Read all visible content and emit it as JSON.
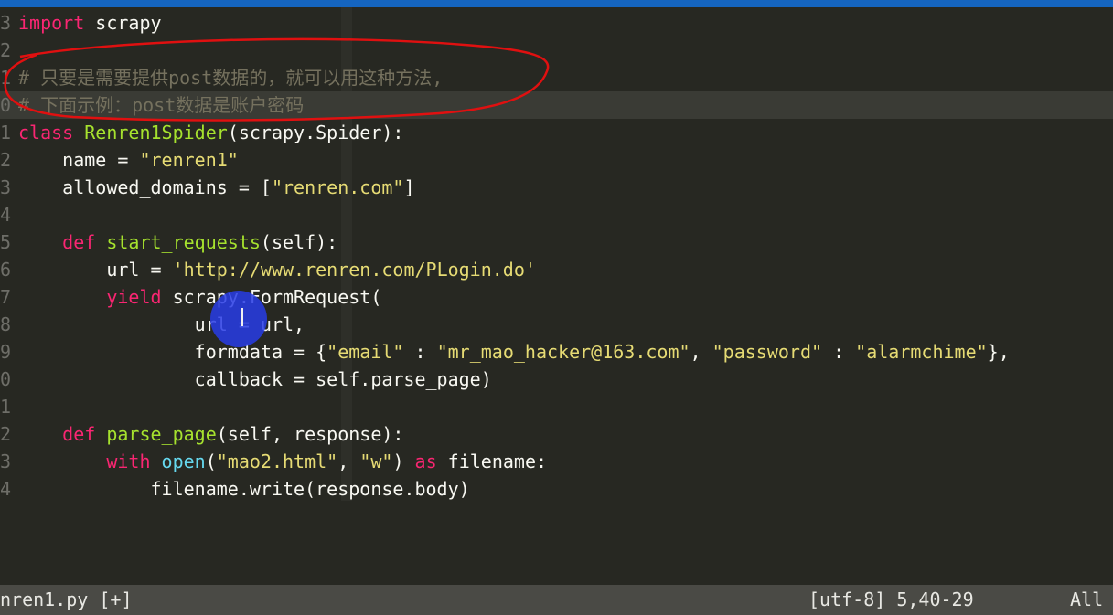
{
  "editor": {
    "lines": [
      {
        "ln": "3",
        "tokens": [
          {
            "t": "import",
            "c": "kw"
          },
          {
            "t": " scrapy",
            "c": "tok"
          }
        ]
      },
      {
        "ln": "2",
        "tokens": []
      },
      {
        "ln": "1",
        "tokens": [
          {
            "t": "# 只要是需要提供post数据的，就可以用这种方法,",
            "c": "com"
          }
        ]
      },
      {
        "ln": "0",
        "tokens": [
          {
            "t": "# 下面示例：post数据是账户密码",
            "c": "com"
          }
        ]
      },
      {
        "ln": "1",
        "tokens": [
          {
            "t": "class",
            "c": "kw"
          },
          {
            "t": " ",
            "c": "tok"
          },
          {
            "t": "Renren1Spider",
            "c": "cls"
          },
          {
            "t": "(scrapy.Spider):",
            "c": "tok"
          }
        ]
      },
      {
        "ln": "2",
        "tokens": [
          {
            "t": "    name = ",
            "c": "tok"
          },
          {
            "t": "\"renren1\"",
            "c": "str"
          }
        ]
      },
      {
        "ln": "3",
        "tokens": [
          {
            "t": "    allowed_domains = [",
            "c": "tok"
          },
          {
            "t": "\"renren.com\"",
            "c": "str"
          },
          {
            "t": "]",
            "c": "tok"
          }
        ]
      },
      {
        "ln": "4",
        "tokens": []
      },
      {
        "ln": "5",
        "tokens": [
          {
            "t": "    ",
            "c": "tok"
          },
          {
            "t": "def",
            "c": "kw"
          },
          {
            "t": " ",
            "c": "tok"
          },
          {
            "t": "start_requests",
            "c": "fn"
          },
          {
            "t": "(self):",
            "c": "tok"
          }
        ]
      },
      {
        "ln": "6",
        "tokens": [
          {
            "t": "        url = ",
            "c": "tok"
          },
          {
            "t": "'http://www.renren.com/PLogin.do'",
            "c": "str"
          }
        ]
      },
      {
        "ln": "7",
        "tokens": [
          {
            "t": "        ",
            "c": "tok"
          },
          {
            "t": "yield",
            "c": "kw"
          },
          {
            "t": " scrapy.FormRequest(",
            "c": "tok"
          }
        ]
      },
      {
        "ln": "8",
        "tokens": [
          {
            "t": "                url = url,",
            "c": "tok"
          }
        ]
      },
      {
        "ln": "9",
        "tokens": [
          {
            "t": "                formdata = {",
            "c": "tok"
          },
          {
            "t": "\"email\"",
            "c": "str"
          },
          {
            "t": " : ",
            "c": "tok"
          },
          {
            "t": "\"mr_mao_hacker@163.com\"",
            "c": "str"
          },
          {
            "t": ", ",
            "c": "tok"
          },
          {
            "t": "\"password\"",
            "c": "str"
          },
          {
            "t": " : ",
            "c": "tok"
          },
          {
            "t": "\"alarmchime\"",
            "c": "str"
          },
          {
            "t": "},",
            "c": "tok"
          }
        ]
      },
      {
        "ln": "0",
        "tokens": [
          {
            "t": "                callback = self.parse_page)",
            "c": "tok"
          }
        ]
      },
      {
        "ln": "1",
        "tokens": []
      },
      {
        "ln": "2",
        "tokens": [
          {
            "t": "    ",
            "c": "tok"
          },
          {
            "t": "def",
            "c": "kw"
          },
          {
            "t": " ",
            "c": "tok"
          },
          {
            "t": "parse_page",
            "c": "fn"
          },
          {
            "t": "(self, response):",
            "c": "tok"
          }
        ]
      },
      {
        "ln": "3",
        "tokens": [
          {
            "t": "        ",
            "c": "tok"
          },
          {
            "t": "with",
            "c": "kw"
          },
          {
            "t": " ",
            "c": "tok"
          },
          {
            "t": "open",
            "c": "bi"
          },
          {
            "t": "(",
            "c": "tok"
          },
          {
            "t": "\"mao2.html\"",
            "c": "str"
          },
          {
            "t": ", ",
            "c": "tok"
          },
          {
            "t": "\"w\"",
            "c": "str"
          },
          {
            "t": ") ",
            "c": "tok"
          },
          {
            "t": "as",
            "c": "kw"
          },
          {
            "t": " filename:",
            "c": "tok"
          }
        ]
      },
      {
        "ln": "4",
        "tokens": [
          {
            "t": "            filename.write(response.body)",
            "c": "tok"
          }
        ]
      }
    ]
  },
  "status": {
    "file": "nren1.py [+]",
    "position": "[utf-8] 5,40-29",
    "scroll": "All"
  },
  "colors": {
    "accent_top_bar": "#1565c0",
    "annotation_red": "#e01010",
    "mouse_highlight": "#283ce6"
  }
}
